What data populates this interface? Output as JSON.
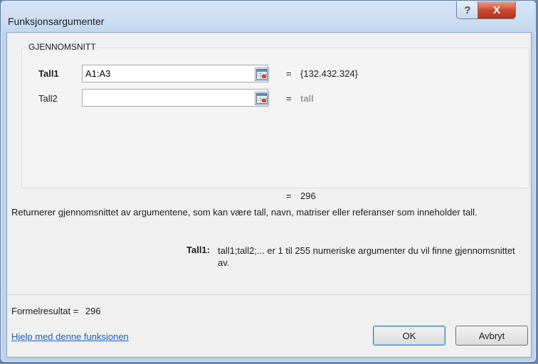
{
  "window": {
    "title": "Funksjonsargumenter",
    "help_glyph": "?",
    "close_glyph": "X"
  },
  "function_group": {
    "name": "GJENNOMSNITT",
    "args": [
      {
        "label": "Tall1",
        "value": "A1:A3",
        "eq": "=",
        "result": "{132.432.324}"
      },
      {
        "label": "Tall2",
        "value": "",
        "eq": "=",
        "result": "tall"
      }
    ]
  },
  "result_line": {
    "eq": "=",
    "value": "296"
  },
  "description": "Returnerer gjennomsnittet av argumentene, som kan være tall, navn, matriser eller referanser som inneholder tall.",
  "argument_help": {
    "label": "Tall1:",
    "text": "tall1;tall2;... er 1 til 255 numeriske argumenter du vil finne gjennomsnittet av."
  },
  "formula_result": {
    "label": "Formelresultat =",
    "value": "296"
  },
  "help_link": "Hjelp med denne funksjonen",
  "buttons": {
    "ok": "OK",
    "cancel": "Avbryt"
  }
}
